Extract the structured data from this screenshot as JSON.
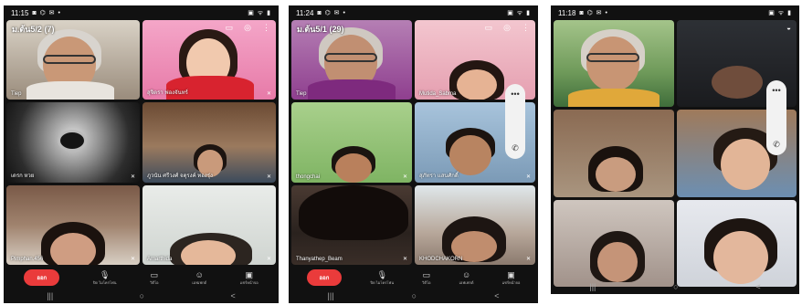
{
  "phones": [
    {
      "time": "11:15",
      "status_icons": "◙ ⌬ ✉ •",
      "status_right": "▣ ᯤ ▮",
      "meeting_title": "ม.ต้น5/2 (7)",
      "tiles": [
        {
          "name": "Tiep"
        },
        {
          "name": "สุจิตรา ฟองจันทร์"
        },
        {
          "name": "เดรก หวย"
        },
        {
          "name": "ภูวนัน ศรีวงศ์ จตุรงค์ ทองรุ่ง"
        },
        {
          "name": "Pimphan.456"
        },
        {
          "name": "Amarthida"
        }
      ],
      "controls": {
        "leave": "ออก",
        "mic": "ปิด ไมโครโฟน",
        "video": "วิดีโอ",
        "effects": "เอฟเฟกต์",
        "present": "แชร์หน้าจอ"
      }
    },
    {
      "time": "11:24",
      "status_icons": "◙ ⌬ ✉ •",
      "status_right": "▣ ᯤ ▮",
      "meeting_title": "ม.ต้น5/1 (29)",
      "tiles": [
        {
          "name": "Tiep"
        },
        {
          "name": "Mutida_Sabma"
        },
        {
          "name": "thongchai"
        },
        {
          "name": "สุภัทรา แสนศักดิ์"
        },
        {
          "name": "Thanyathep_Beam"
        },
        {
          "name": "KHODCHAKORN"
        }
      ],
      "controls": {
        "leave": "ออก",
        "mic": "ปิด ไมโครโฟน",
        "video": "วิดีโอ",
        "effects": "เอฟเฟกต์",
        "present": "แชร์หน้าจอ"
      }
    },
    {
      "time": "11:18",
      "status_icons": "◙ ⌬ ✉ •",
      "status_right": "▣ ᯤ ▮",
      "tiles": [
        {},
        {},
        {},
        {},
        {},
        {}
      ]
    }
  ],
  "navbar": {
    "recent": "|||",
    "home": "○",
    "back": "<"
  }
}
